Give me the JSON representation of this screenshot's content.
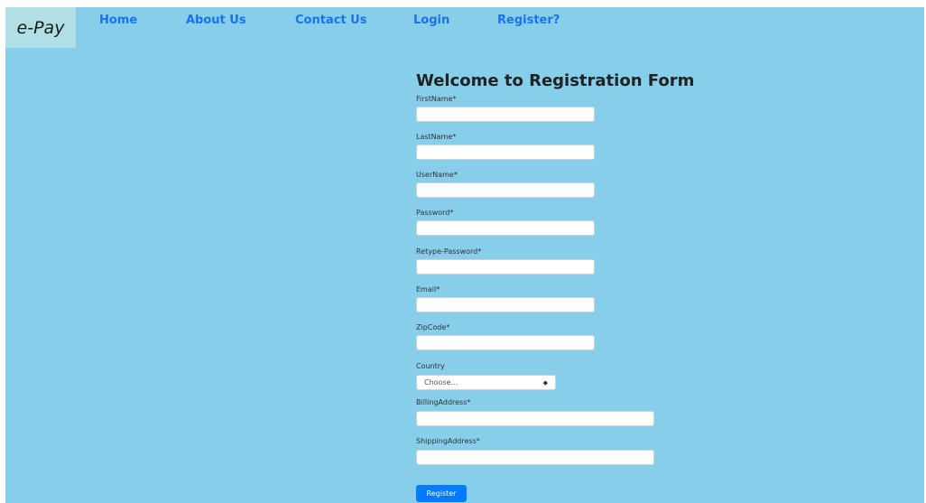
{
  "brand": "e-Pay",
  "nav": {
    "home": "Home",
    "about": "About Us",
    "contact": "Contact Us",
    "login": "Login",
    "register": "Register?"
  },
  "form": {
    "title": "Welcome to Registration Form",
    "fields": {
      "firstname": "FirstName*",
      "lastname": "LastName*",
      "username": "UserName*",
      "password": "Password*",
      "retype_password": "Retype-Password*",
      "email": "Email*",
      "zipcode": "ZipCode*",
      "country": "Country",
      "billing": "BillingAddress*",
      "shipping": "ShippingAddress*"
    },
    "country_selected": "Choose...",
    "submit": "Register"
  },
  "colors": {
    "background": "#87ceeb",
    "brand_bg": "#b0e0e6",
    "nav_link": "#1a73e8",
    "button": "#007bff"
  }
}
